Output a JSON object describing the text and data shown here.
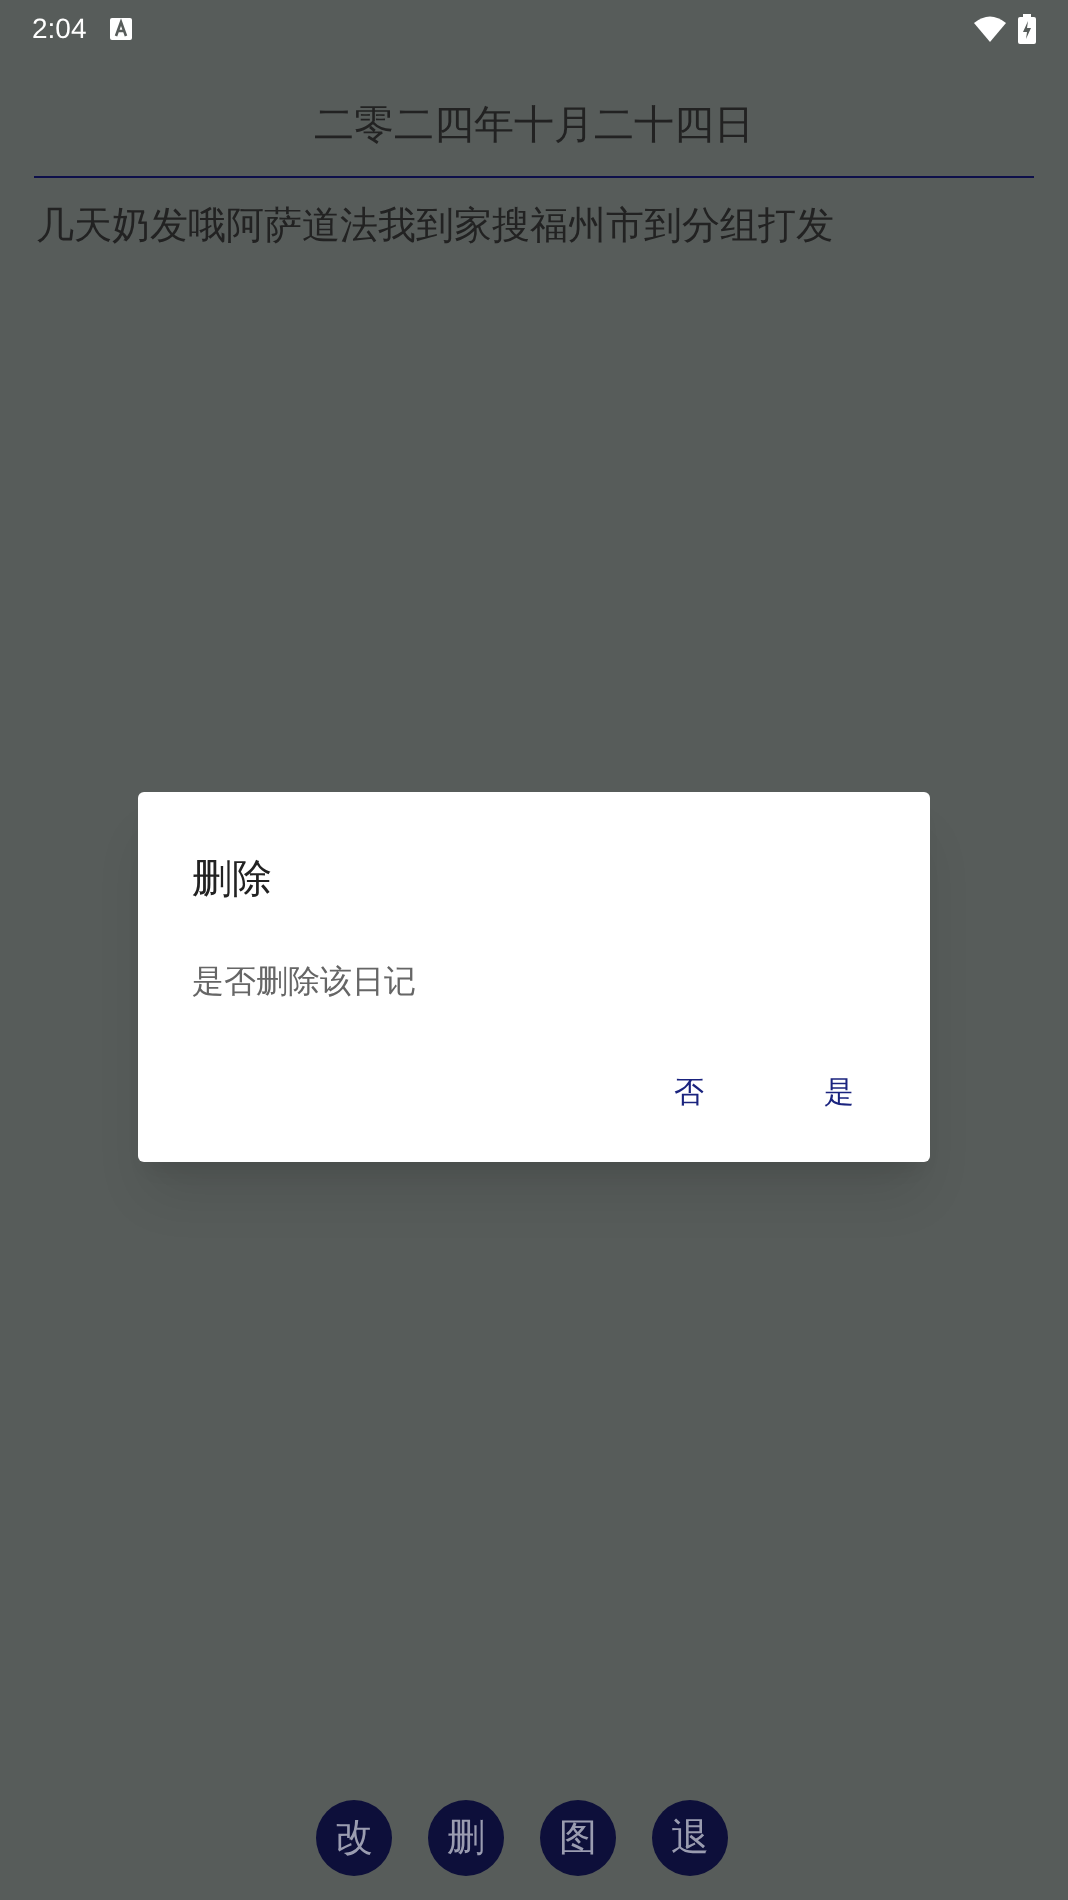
{
  "status_bar": {
    "time": "2:04"
  },
  "diary": {
    "date": "二零二四年十月二十四日",
    "content": "几天奶发哦阿萨道法我到家搜福州市到分组打发"
  },
  "dialog": {
    "title": "删除",
    "message": "是否删除该日记",
    "buttons": [
      "否",
      "是"
    ]
  },
  "actions": [
    "改",
    "删",
    "图",
    "退"
  ]
}
